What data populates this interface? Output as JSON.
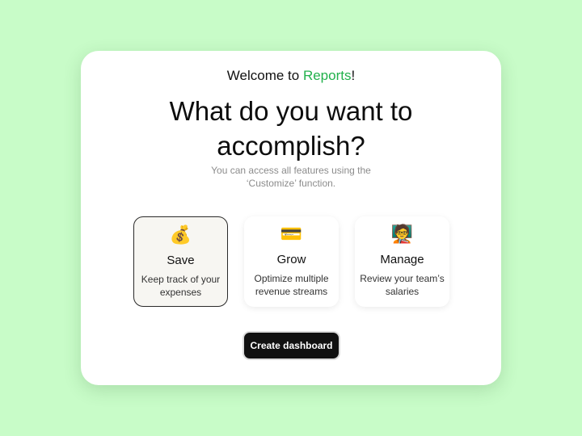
{
  "welcome": {
    "prefix": "Welcome to ",
    "app_name": "Reports",
    "suffix": "!"
  },
  "headline": "What do you want to accomplish?",
  "subtext": "You can access all features using the ‘Customize’ function.",
  "options": [
    {
      "icon": "💰",
      "icon_name": "money-bag-icon",
      "title": "Save",
      "description": "Keep track of your expenses",
      "selected": true
    },
    {
      "icon": "💳",
      "icon_name": "credit-card-icon",
      "title": "Grow",
      "description": "Optimize multiple revenue streams",
      "selected": false
    },
    {
      "icon": "🧑‍🏫",
      "icon_name": "teacher-icon",
      "title": "Manage",
      "description": "Review your team’s salaries",
      "selected": false
    }
  ],
  "create_button_label": "Create dashboard",
  "colors": {
    "background": "#c8fcc8",
    "accent": "#22b14c",
    "button": "#111111"
  }
}
